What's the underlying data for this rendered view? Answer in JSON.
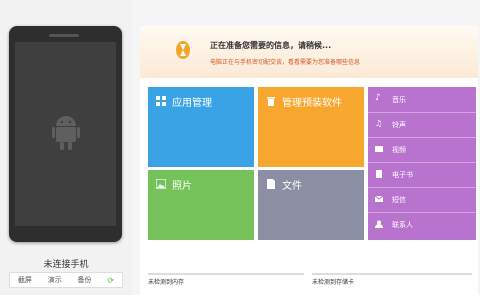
{
  "phone": {
    "name": "未连接手机",
    "actions": [
      "截屏",
      "演示",
      "备份"
    ]
  },
  "banner": {
    "title": "正在准备您需要的信息，请稍候...",
    "subtitle": "电脑正在与手机密切配交谈，看看需要为您准备哪些信息"
  },
  "tiles": {
    "app": "应用管理",
    "preinstalled": "管理预装软件",
    "photo": "照片",
    "file": "文件"
  },
  "purple_items": [
    "音乐",
    "铃声",
    "视频",
    "电子书",
    "短信",
    "联系人"
  ],
  "storage": {
    "internal": "未检测到内存",
    "sd": "未检测到存储卡"
  },
  "colors": {
    "app": "#3aa3e6",
    "preinstalled": "#f7a72d",
    "photo": "#75c25a",
    "file": "#8c8fa4",
    "purple": "#b873cf"
  }
}
